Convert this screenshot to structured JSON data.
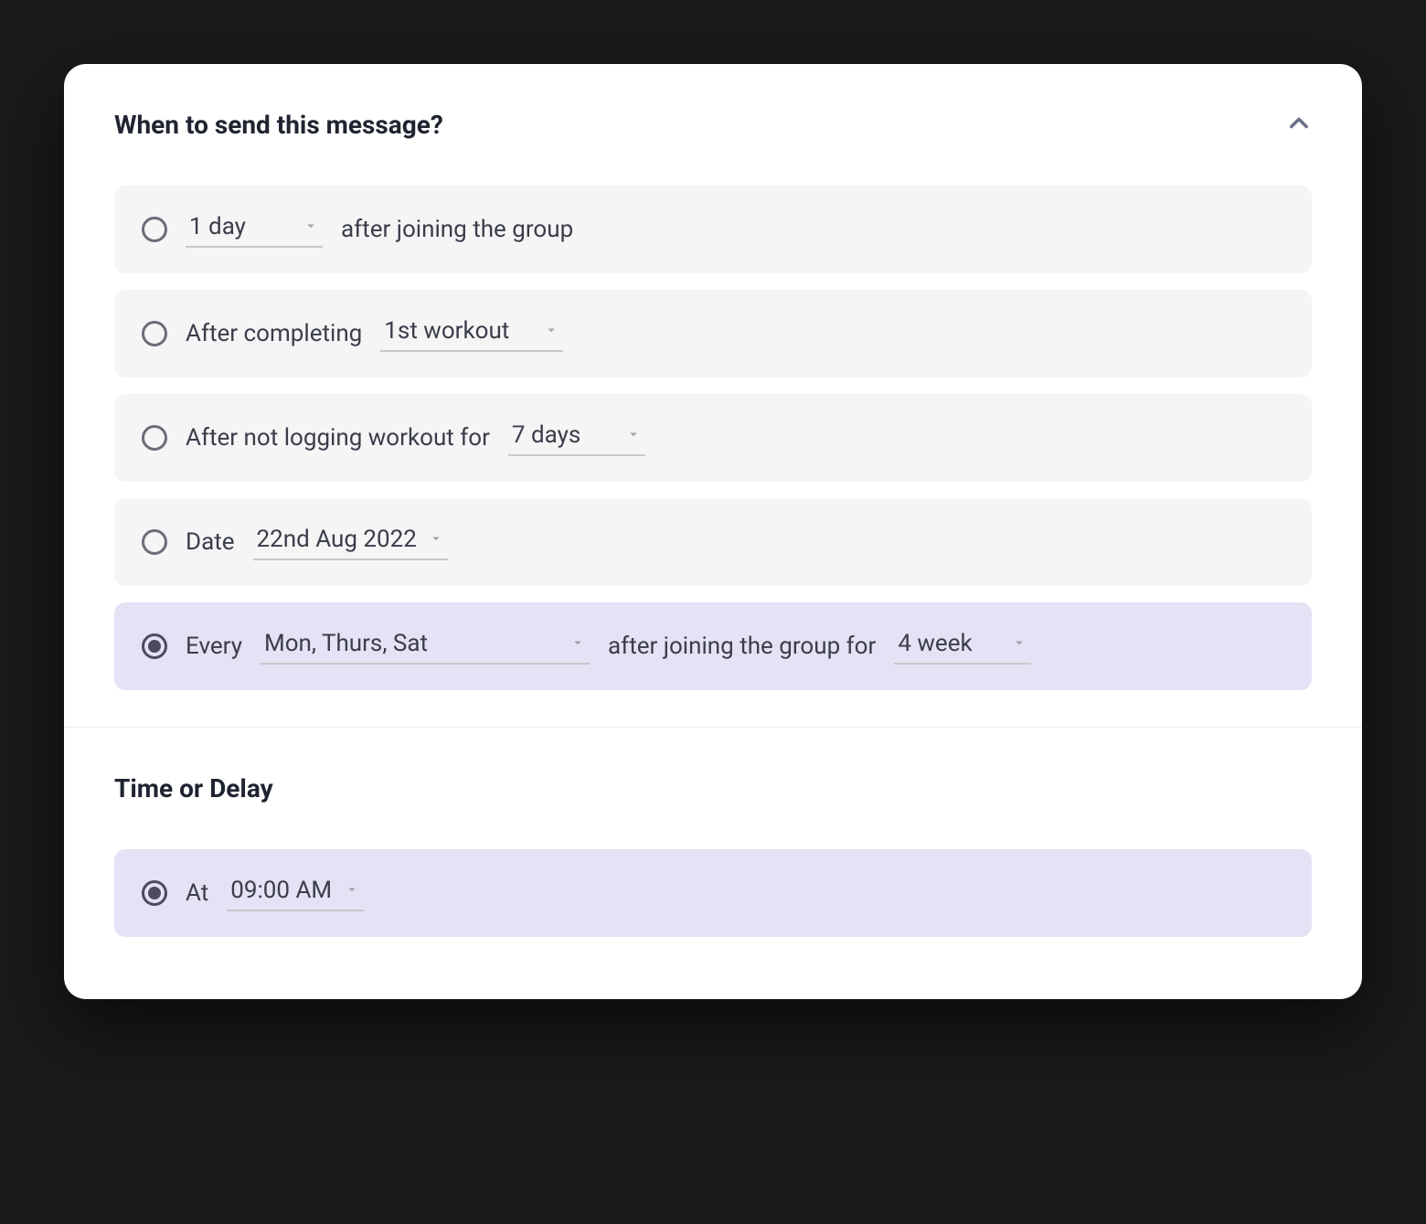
{
  "header": {
    "title": "When to send this message?"
  },
  "options": {
    "opt1": {
      "duration": "1 day",
      "suffix": "after joining the group"
    },
    "opt2": {
      "prefix": "After completing",
      "workout": "1st workout"
    },
    "opt3": {
      "prefix": "After not logging workout for",
      "duration": "7 days"
    },
    "opt4": {
      "prefix": "Date",
      "date": "22nd Aug 2022"
    },
    "opt5": {
      "prefix": "Every",
      "days": "Mon, Thurs, Sat",
      "mid": "after joining the group for",
      "duration": "4 week"
    }
  },
  "time_section": {
    "title": "Time or Delay",
    "at": {
      "prefix": "At",
      "value": "09:00 AM"
    }
  }
}
